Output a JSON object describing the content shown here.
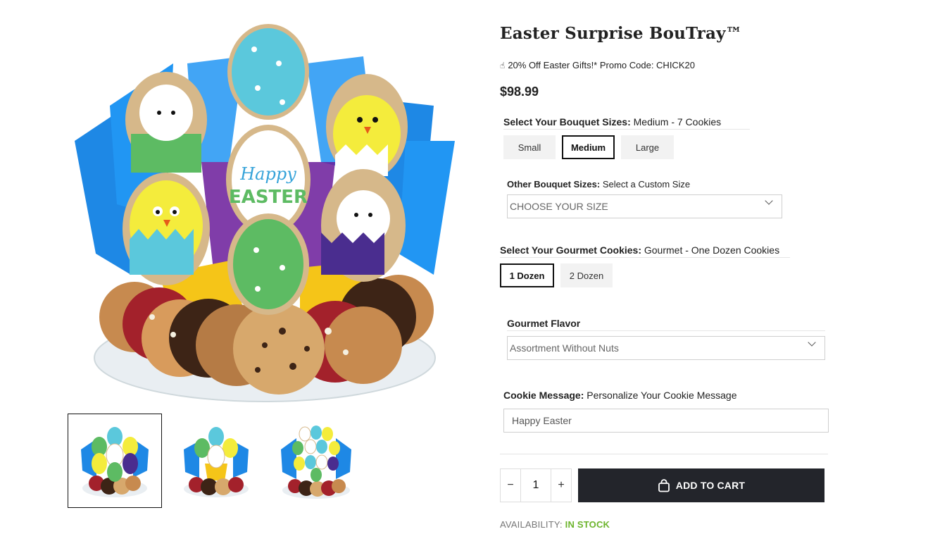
{
  "product": {
    "title": "Easter Surprise BouTray™",
    "promo_icon": "hand-icon",
    "promo_text": "20% Off Easter Gifts!* Promo Code: CHICK20",
    "price": "$98.99"
  },
  "gallery": {
    "main_image_icon": "cookie-bouquet-image",
    "main_cookie_text_line1": "Happy",
    "main_cookie_text_line2": "EASTER",
    "thumbnails": [
      {
        "name": "thumbnail-1",
        "active": true
      },
      {
        "name": "thumbnail-2",
        "active": false
      },
      {
        "name": "thumbnail-3",
        "active": false
      }
    ]
  },
  "bouquet_size": {
    "label": "Select Your Bouquet Sizes:",
    "value": "Medium - 7 Cookies",
    "options": [
      "Small",
      "Medium",
      "Large"
    ],
    "selected": "Medium"
  },
  "other_size": {
    "label": "Other Bouquet Sizes:",
    "value": "Select a Custom Size",
    "placeholder": "CHOOSE YOUR SIZE"
  },
  "cookies": {
    "label": "Select Your Gourmet Cookies:",
    "value": "Gourmet - One Dozen Cookies",
    "options": [
      "1 Dozen",
      "2 Dozen"
    ],
    "selected": "1 Dozen"
  },
  "flavor": {
    "label": "Gourmet Flavor",
    "selected": "Assortment Without Nuts"
  },
  "message": {
    "label": "Cookie Message:",
    "value_label": "Personalize Your Cookie Message",
    "input_value": "Happy Easter"
  },
  "cart": {
    "minus": "−",
    "plus": "+",
    "quantity": "1",
    "button_label": "ADD TO CART",
    "button_icon": "shopping-bag-icon"
  },
  "availability": {
    "label": "AVAILABILITY:",
    "status": "IN STOCK",
    "status_color": "#6cb42c"
  },
  "colors": {
    "cart_button": "#23252b",
    "tissue_blue": "#1e90e0",
    "egg_teal": "#5bc8dc",
    "chick_yellow": "#f4ec3c",
    "grass_green": "#5dbb63",
    "purple": "#5a3fa6"
  }
}
